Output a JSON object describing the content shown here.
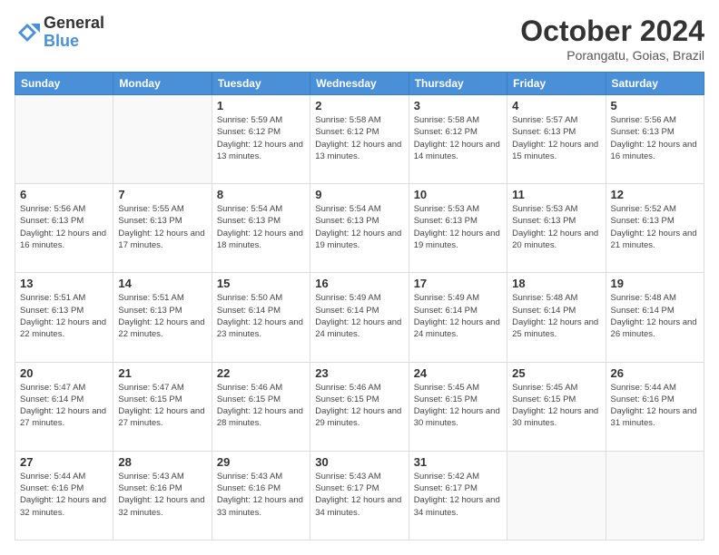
{
  "header": {
    "logo_general": "General",
    "logo_blue": "Blue",
    "month": "October 2024",
    "location": "Porangatu, Goias, Brazil"
  },
  "days_of_week": [
    "Sunday",
    "Monday",
    "Tuesday",
    "Wednesday",
    "Thursday",
    "Friday",
    "Saturday"
  ],
  "weeks": [
    [
      {
        "day": "",
        "info": ""
      },
      {
        "day": "",
        "info": ""
      },
      {
        "day": "1",
        "info": "Sunrise: 5:59 AM\nSunset: 6:12 PM\nDaylight: 12 hours and 13 minutes."
      },
      {
        "day": "2",
        "info": "Sunrise: 5:58 AM\nSunset: 6:12 PM\nDaylight: 12 hours and 13 minutes."
      },
      {
        "day": "3",
        "info": "Sunrise: 5:58 AM\nSunset: 6:12 PM\nDaylight: 12 hours and 14 minutes."
      },
      {
        "day": "4",
        "info": "Sunrise: 5:57 AM\nSunset: 6:13 PM\nDaylight: 12 hours and 15 minutes."
      },
      {
        "day": "5",
        "info": "Sunrise: 5:56 AM\nSunset: 6:13 PM\nDaylight: 12 hours and 16 minutes."
      }
    ],
    [
      {
        "day": "6",
        "info": "Sunrise: 5:56 AM\nSunset: 6:13 PM\nDaylight: 12 hours and 16 minutes."
      },
      {
        "day": "7",
        "info": "Sunrise: 5:55 AM\nSunset: 6:13 PM\nDaylight: 12 hours and 17 minutes."
      },
      {
        "day": "8",
        "info": "Sunrise: 5:54 AM\nSunset: 6:13 PM\nDaylight: 12 hours and 18 minutes."
      },
      {
        "day": "9",
        "info": "Sunrise: 5:54 AM\nSunset: 6:13 PM\nDaylight: 12 hours and 19 minutes."
      },
      {
        "day": "10",
        "info": "Sunrise: 5:53 AM\nSunset: 6:13 PM\nDaylight: 12 hours and 19 minutes."
      },
      {
        "day": "11",
        "info": "Sunrise: 5:53 AM\nSunset: 6:13 PM\nDaylight: 12 hours and 20 minutes."
      },
      {
        "day": "12",
        "info": "Sunrise: 5:52 AM\nSunset: 6:13 PM\nDaylight: 12 hours and 21 minutes."
      }
    ],
    [
      {
        "day": "13",
        "info": "Sunrise: 5:51 AM\nSunset: 6:13 PM\nDaylight: 12 hours and 22 minutes."
      },
      {
        "day": "14",
        "info": "Sunrise: 5:51 AM\nSunset: 6:13 PM\nDaylight: 12 hours and 22 minutes."
      },
      {
        "day": "15",
        "info": "Sunrise: 5:50 AM\nSunset: 6:14 PM\nDaylight: 12 hours and 23 minutes."
      },
      {
        "day": "16",
        "info": "Sunrise: 5:49 AM\nSunset: 6:14 PM\nDaylight: 12 hours and 24 minutes."
      },
      {
        "day": "17",
        "info": "Sunrise: 5:49 AM\nSunset: 6:14 PM\nDaylight: 12 hours and 24 minutes."
      },
      {
        "day": "18",
        "info": "Sunrise: 5:48 AM\nSunset: 6:14 PM\nDaylight: 12 hours and 25 minutes."
      },
      {
        "day": "19",
        "info": "Sunrise: 5:48 AM\nSunset: 6:14 PM\nDaylight: 12 hours and 26 minutes."
      }
    ],
    [
      {
        "day": "20",
        "info": "Sunrise: 5:47 AM\nSunset: 6:14 PM\nDaylight: 12 hours and 27 minutes."
      },
      {
        "day": "21",
        "info": "Sunrise: 5:47 AM\nSunset: 6:15 PM\nDaylight: 12 hours and 27 minutes."
      },
      {
        "day": "22",
        "info": "Sunrise: 5:46 AM\nSunset: 6:15 PM\nDaylight: 12 hours and 28 minutes."
      },
      {
        "day": "23",
        "info": "Sunrise: 5:46 AM\nSunset: 6:15 PM\nDaylight: 12 hours and 29 minutes."
      },
      {
        "day": "24",
        "info": "Sunrise: 5:45 AM\nSunset: 6:15 PM\nDaylight: 12 hours and 30 minutes."
      },
      {
        "day": "25",
        "info": "Sunrise: 5:45 AM\nSunset: 6:15 PM\nDaylight: 12 hours and 30 minutes."
      },
      {
        "day": "26",
        "info": "Sunrise: 5:44 AM\nSunset: 6:16 PM\nDaylight: 12 hours and 31 minutes."
      }
    ],
    [
      {
        "day": "27",
        "info": "Sunrise: 5:44 AM\nSunset: 6:16 PM\nDaylight: 12 hours and 32 minutes."
      },
      {
        "day": "28",
        "info": "Sunrise: 5:43 AM\nSunset: 6:16 PM\nDaylight: 12 hours and 32 minutes."
      },
      {
        "day": "29",
        "info": "Sunrise: 5:43 AM\nSunset: 6:16 PM\nDaylight: 12 hours and 33 minutes."
      },
      {
        "day": "30",
        "info": "Sunrise: 5:43 AM\nSunset: 6:17 PM\nDaylight: 12 hours and 34 minutes."
      },
      {
        "day": "31",
        "info": "Sunrise: 5:42 AM\nSunset: 6:17 PM\nDaylight: 12 hours and 34 minutes."
      },
      {
        "day": "",
        "info": ""
      },
      {
        "day": "",
        "info": ""
      }
    ]
  ]
}
